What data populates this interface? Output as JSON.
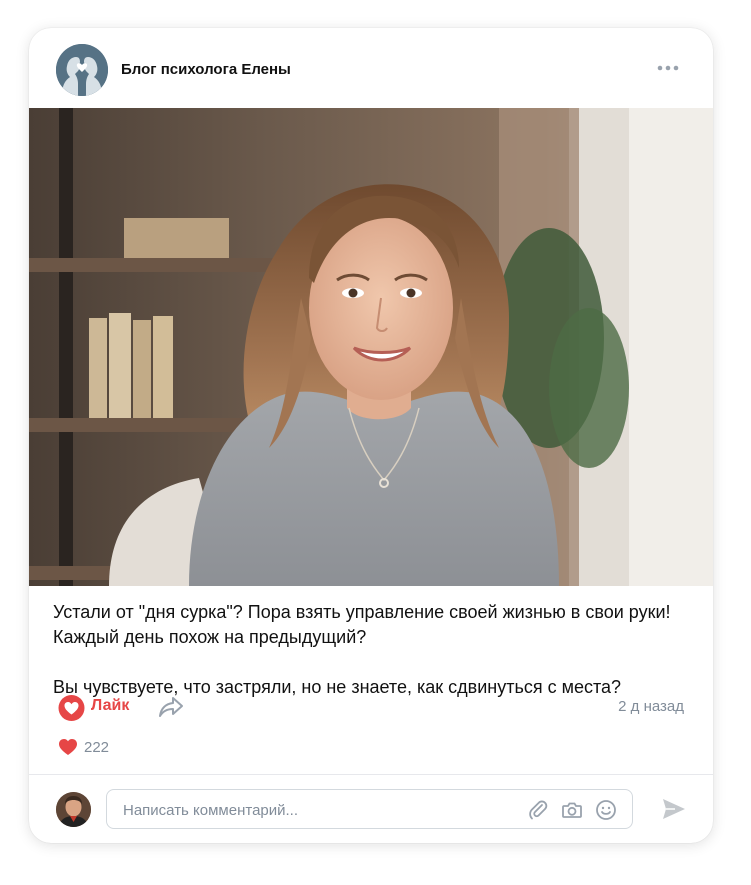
{
  "post": {
    "author": "Блог психолога Елены",
    "text_lines": [
      "Устали от \"дня сурка\"? Пора взять управление своей жизнью в свои руки!",
      "Каждый день похож на предыдущий?",
      "",
      "Вы чувствуете, что застряли, но не знаете, как сдвинуться с места?"
    ],
    "like_label": "Лайк",
    "time": "2 д назад",
    "likes_count": "222"
  },
  "comment": {
    "placeholder": "Написать комментарий..."
  },
  "icons": {
    "more": "more-horizontal-icon",
    "like": "heart-icon",
    "share": "share-arrow-icon",
    "attach": "paperclip-icon",
    "camera": "camera-icon",
    "emoji": "smile-icon",
    "send": "send-icon"
  },
  "colors": {
    "like_red": "#e64646",
    "muted": "#818c99",
    "avatar_bg": "#567285"
  }
}
